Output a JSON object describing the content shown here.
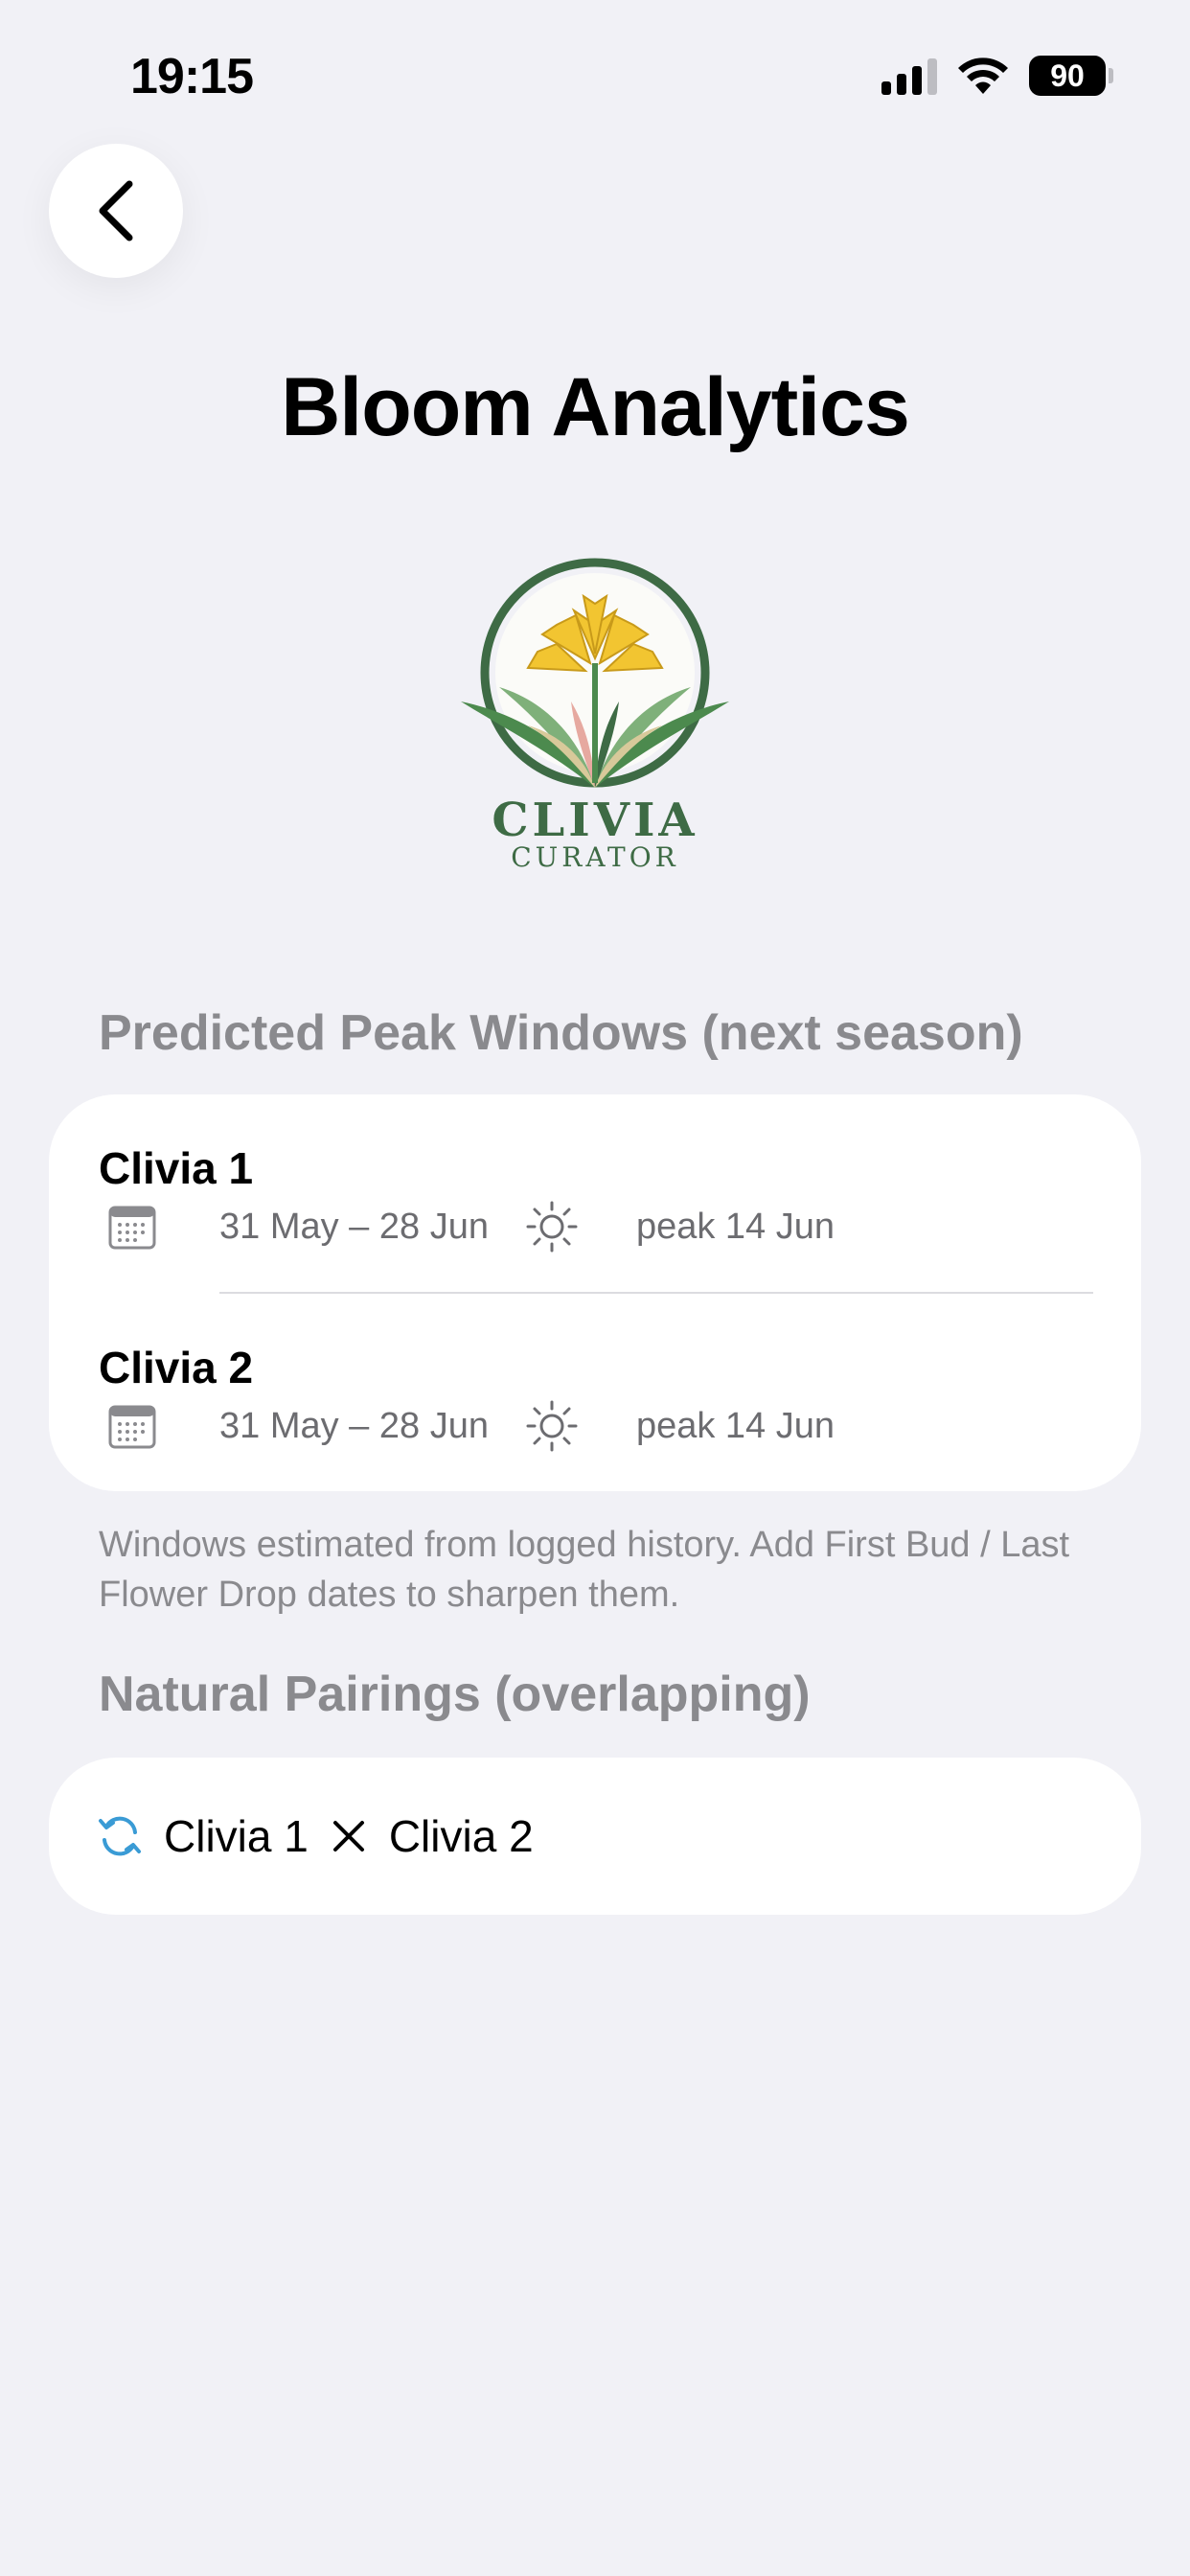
{
  "status_bar": {
    "time": "19:15",
    "battery": "90"
  },
  "header": {
    "title": "Bloom Analytics",
    "back_icon": "chevron-left-icon"
  },
  "logo": {
    "line1": "CLIVIA",
    "line2": "CURATOR"
  },
  "peak_windows": {
    "header": "Predicted Peak Windows (next season)",
    "items": [
      {
        "name": "Clivia 1",
        "range": "31 May – 28 Jun",
        "peak": "peak 14 Jun"
      },
      {
        "name": "Clivia 2",
        "range": "31 May – 28 Jun",
        "peak": "peak 14 Jun"
      }
    ],
    "footnote": "Windows estimated from logged history. Add First Bud / Last Flower Drop dates to sharpen them."
  },
  "pairings": {
    "header": "Natural Pairings (overlapping)",
    "items": [
      {
        "a": "Clivia 1",
        "b": "Clivia 2"
      }
    ]
  },
  "colors": {
    "background": "#F1F1F6",
    "card": "#FFFFFF",
    "secondary_text": "#8A8A8E",
    "accent": "#3A9BD5",
    "logo_green": "#3E6B45",
    "flower_yellow": "#F2C531"
  }
}
